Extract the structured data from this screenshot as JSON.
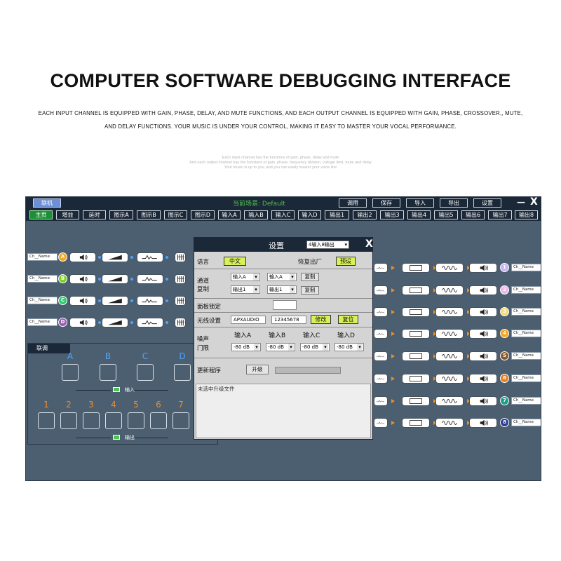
{
  "header": {
    "title": "COMPUTER SOFTWARE DEBUGGING INTERFACE",
    "line1": "EACH INPUT CHANNEL IS EQUIPPED WITH GAIN, PHASE, DELAY, AND MUTE FUNCTIONS, AND EACH OUTPUT CHANNEL IS EQUIPPED WITH GAIN, PHASE, CROSSOVER,, MUTE,",
    "line2": "AND DELAY FUNCTIONS. YOUR MUSIC IS UNDER YOUR CONTROL, MAKING IT EASY TO MASTER YOUR VOCAL PERFORMANCE.",
    "faint1": "Each input channel has the functions of gain, phase, delay and mute",
    "faint2": "And each output channel has the functions of gain, phase, frequency division, voltage limit, mute and delay",
    "faint3": "Your music is up to you, and you can easily master your voice line"
  },
  "topbar": {
    "connect": "联机",
    "scene": "当前场景: Default",
    "buttons": [
      "调用",
      "保存",
      "导入",
      "导出",
      "设置"
    ],
    "minimize": "—",
    "close": "X"
  },
  "tabs": [
    "主页",
    "增益",
    "延时",
    "图示A",
    "图示B",
    "图示C",
    "图示D",
    "输入A",
    "输入B",
    "输入C",
    "输入D",
    "输出1",
    "输出2",
    "输出3",
    "输出4",
    "输出5",
    "输出6",
    "输出7",
    "输出8"
  ],
  "inputs": [
    {
      "name": "Ch__Name",
      "letter": "A",
      "color": "#f5a623"
    },
    {
      "name": "Ch__Name",
      "letter": "B",
      "color": "#7ed321"
    },
    {
      "name": "Ch__Name",
      "letter": "C",
      "color": "#2ecc71"
    },
    {
      "name": "Ch__Name",
      "letter": "D",
      "color": "#9b59b6"
    }
  ],
  "outputs": [
    {
      "name": "Ch__Name",
      "num": "1",
      "color": "#c5b6f0"
    },
    {
      "name": "Ch__Name",
      "num": "2",
      "color": "#f0b6e8"
    },
    {
      "name": "Ch__Name",
      "num": "3",
      "color": "#f5d87a"
    },
    {
      "name": "Ch__Name",
      "num": "4",
      "color": "#f5a623"
    },
    {
      "name": "Ch__Name",
      "num": "5",
      "color": "#8b5a2b"
    },
    {
      "name": "Ch__Name",
      "num": "6",
      "color": "#e67e22"
    },
    {
      "name": "Ch__Name",
      "num": "7",
      "color": "#16a085"
    },
    {
      "name": "Ch__Name",
      "num": "8",
      "color": "#2c3e8f"
    }
  ],
  "link": {
    "title": "联调",
    "letters": [
      "A",
      "B",
      "C",
      "D"
    ],
    "input_caption": "输入",
    "numbers": [
      "1",
      "2",
      "3",
      "4",
      "5",
      "6",
      "7"
    ],
    "output_caption": "输出"
  },
  "dialog": {
    "title": "设置",
    "mode": "4输入8输出",
    "close": "X",
    "language_label": "语言",
    "language_btn": "中文",
    "reset_label": "恢复出厂",
    "reset_btn": "预设",
    "copy_label1": "通道",
    "copy_label2": "复制",
    "copy_in_from": "输入A",
    "copy_in_to": "输入A",
    "copy_btn1": "复制",
    "copy_out_from": "输出1",
    "copy_out_to": "输出1",
    "copy_btn2": "复制",
    "lock_label": "面板锁定",
    "wireless_label": "无线设置",
    "ssid": "APXAUDIO",
    "password": "12345678",
    "modify_btn": "修改",
    "restore_btn": "复位",
    "noise_label1": "噪声",
    "noise_label2": "门限",
    "gate_headers": [
      "输入A",
      "输入B",
      "输入C",
      "输入D"
    ],
    "gate_values": [
      "-80 dB",
      "-80 dB",
      "-80 dB",
      "-80 dB"
    ],
    "update_label": "更新程序",
    "upgrade_btn": "升级",
    "log_text": "未选中升级文件"
  },
  "colors": {
    "app_bg": "#4c5f71",
    "bar_bg": "#1b2838",
    "accent_blue": "#4da3ff",
    "accent_orange": "#f08a24",
    "active_tab": "#1f8f37",
    "dialog_btn": "#d9f05a"
  }
}
